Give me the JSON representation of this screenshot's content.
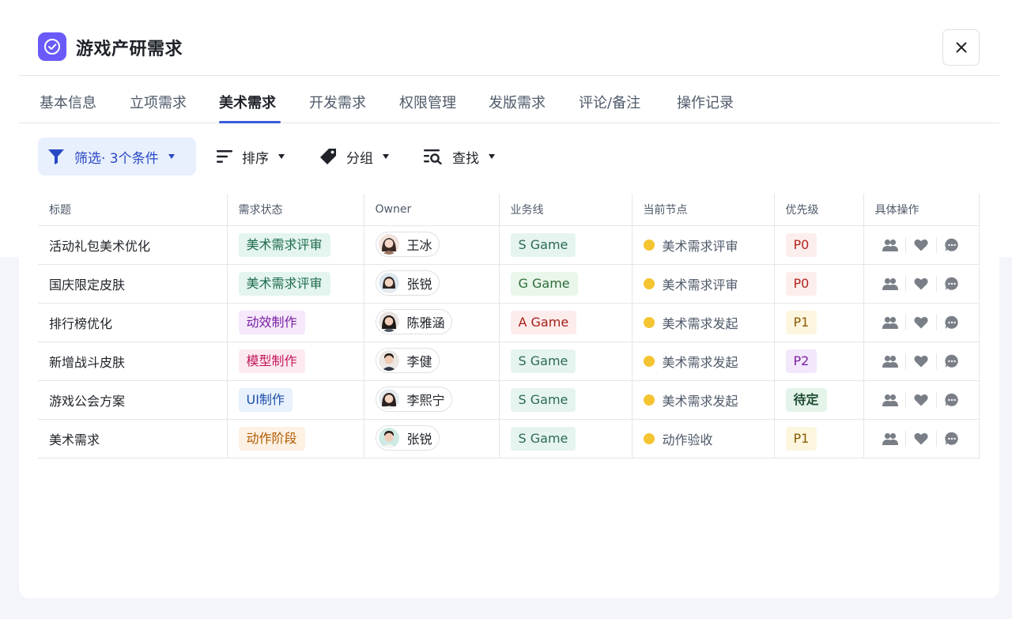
{
  "header": {
    "title": "游戏产研需求"
  },
  "tabs": [
    {
      "label": "基本信息",
      "active": false
    },
    {
      "label": "立项需求",
      "active": false
    },
    {
      "label": "美术需求",
      "active": true
    },
    {
      "label": "开发需求",
      "active": false
    },
    {
      "label": "权限管理",
      "active": false
    },
    {
      "label": "发版需求",
      "active": false
    },
    {
      "label": "评论/备注",
      "active": false
    },
    {
      "label": "操作记录",
      "active": false
    }
  ],
  "toolbar": {
    "filter_label": "筛选· 3个条件",
    "sort_label": "排序",
    "group_label": "分组",
    "find_label": "查找"
  },
  "table": {
    "columns": [
      "标题",
      "需求状态",
      "Owner",
      "业务线",
      "当前节点",
      "优先级",
      "具体操作"
    ],
    "rows": [
      {
        "title": "活动礼包美术优化",
        "status": "美术需求评审",
        "owner": "王冰",
        "line": "S Game",
        "node": "美术需求评审",
        "priority": "P0"
      },
      {
        "title": "国庆限定皮肤",
        "status": "美术需求评审",
        "owner": "张锐",
        "line": "G Game",
        "node": "美术需求评审",
        "priority": "P0"
      },
      {
        "title": "排行榜优化",
        "status": "动效制作",
        "owner": "陈雅涵",
        "line": "A Game",
        "node": "美术需求发起",
        "priority": "P1"
      },
      {
        "title": "新增战斗皮肤",
        "status": "模型制作",
        "owner": "李健",
        "line": "S Game",
        "node": "美术需求发起",
        "priority": "P2"
      },
      {
        "title": "游戏公会方案",
        "status": "UI制作",
        "owner": "李熙宁",
        "line": "S Game",
        "node": "美术需求发起",
        "priority": "待定"
      },
      {
        "title": "美术需求",
        "status": "动作阶段",
        "owner": "张锐",
        "line": "S Game",
        "node": "动作验收",
        "priority": "P1"
      }
    ]
  },
  "colors": {
    "accent": "#3b5bdb",
    "app_icon": "#6a5af9",
    "node_dot": "#f5c431"
  },
  "icons": {
    "app": "check-circle-icon",
    "close": "close-icon",
    "filter": "filter-icon",
    "sort": "sort-icon",
    "group": "tag-icon",
    "find": "search-list-icon",
    "ops": [
      "users-icon",
      "heart-icon",
      "comment-icon"
    ]
  }
}
